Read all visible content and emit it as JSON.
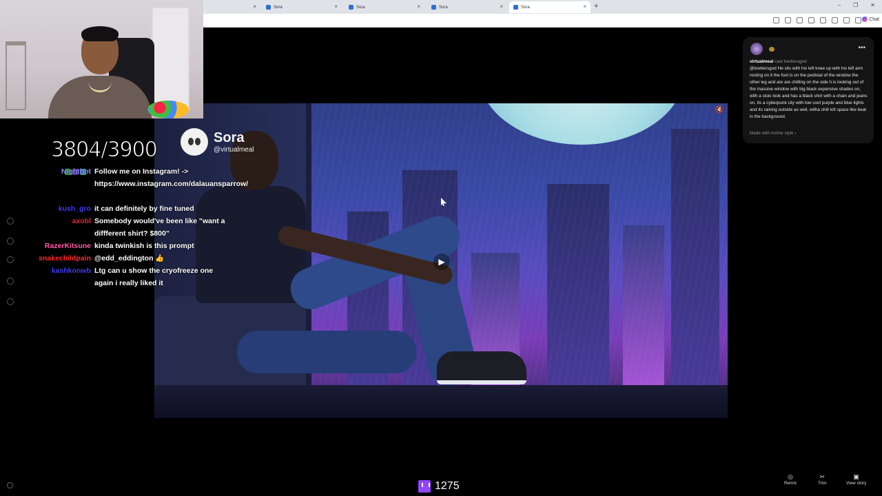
{
  "browser": {
    "tabs": [
      {
        "label": ""
      },
      {
        "label": "Sora"
      },
      {
        "label": "Sora"
      },
      {
        "label": "Sora"
      },
      {
        "label": "Sora",
        "active": true
      }
    ],
    "new_tab": "+",
    "chat_button": "Chat"
  },
  "stream": {
    "counter": "3804/3900",
    "viewer_count": "1275"
  },
  "chat": [
    {
      "user": "Nightbot",
      "color": "#8a8dff",
      "text": "Follow me on Instagram! -> https://www.instagram.com/dalauansparrow/"
    },
    {
      "user": "kush_gro",
      "color": "#3a3aff",
      "text": "it can definitely by fine tuned"
    },
    {
      "user": "axobl",
      "color": "#e3262c",
      "text": "Somebody would've been like \"want a diffferent shirt? $800\""
    },
    {
      "user": "RazerKitsune",
      "color": "#ff5aa8",
      "text": "kinda twinkish is this prompt"
    },
    {
      "user": "snakechildpain",
      "color": "#ff2a2a",
      "text": "@edd_eddington 👍"
    },
    {
      "user": "kashkonwb",
      "color": "#3c3cf0",
      "text": "Ltg can u show the cryofreeze one again i really liked it"
    }
  ],
  "video": {
    "watermark_title": "Sora",
    "watermark_handle": "@virtualmeal"
  },
  "panel": {
    "author": "virtualmeal",
    "cast": "cast lowtiersgod",
    "prompt": "@lowtiersgod He sits with his left knee up with his left arm resting on it the foot is on the pedistal of the window the other leg and are are chilling on the side h is looking out of the massive window with big black expensive shades on, with a stoic look and has a black shirt with a chain and jeans on, its a cyberpunk city with low cool purple and blue lights and its raining outside as well, witha chill lofi space like beat in the background.",
    "made_with": "Made with Anime style",
    "more_icon": "more-icon"
  },
  "controls": {
    "remix": "Remix",
    "trim": "Trim",
    "view_story": "View story"
  }
}
